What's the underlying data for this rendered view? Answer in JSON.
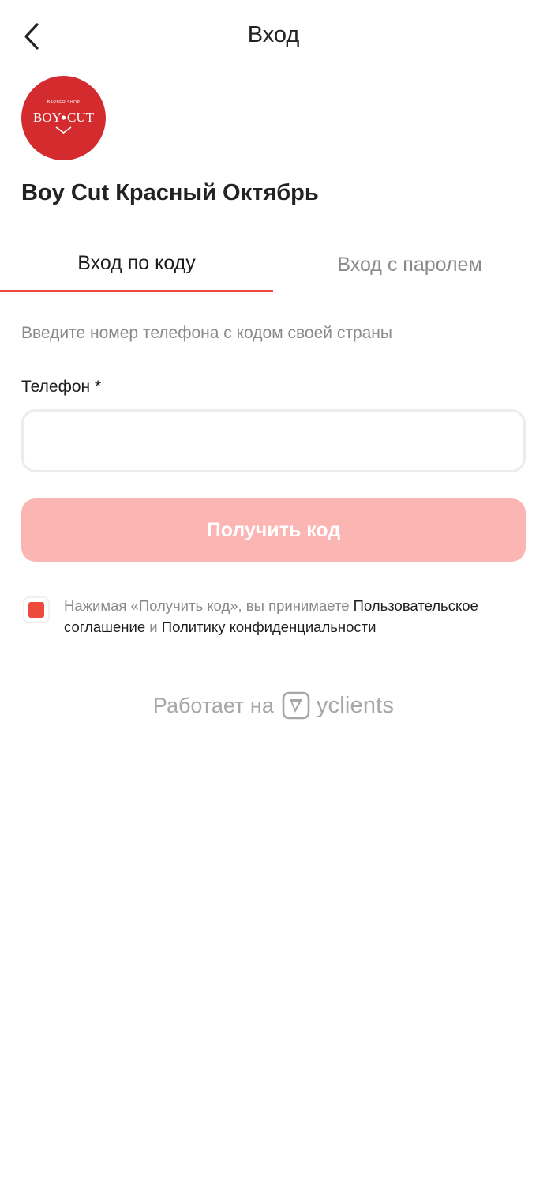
{
  "header": {
    "title": "Вход",
    "back_icon": "chevron-left-icon"
  },
  "company": {
    "logo_text_left": "BOY",
    "logo_text_right": "CUT",
    "logo_subtitle": "BARBER SHOP",
    "name": "Boy Cut Красный Октябрь"
  },
  "tabs": [
    {
      "label": "Вход по коду",
      "active": true
    },
    {
      "label": "Вход с паролем",
      "active": false
    }
  ],
  "form": {
    "hint": "Введите номер телефона с кодом своей страны",
    "phone_label": "Телефон *",
    "phone_value": "",
    "submit_label": "Получить код"
  },
  "consent": {
    "checked": true,
    "text_before": "Нажимая «Получить код», вы принимаете ",
    "agreement_link": "Пользовательское соглашение",
    "text_middle": " и ",
    "privacy_link": "Политику конфиденциальности"
  },
  "powered": {
    "prefix": "Работает на",
    "brand": "yclients"
  },
  "colors": {
    "accent": "#ec4a3c",
    "button_disabled": "#fbb6b3",
    "logo_bg": "#d42b2f",
    "muted_text": "#8a8a8a"
  }
}
